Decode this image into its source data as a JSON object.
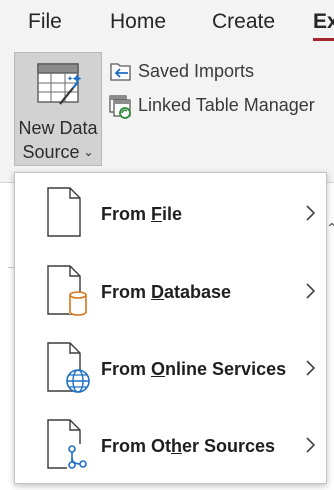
{
  "ribbon_tabs": [
    {
      "label": "File"
    },
    {
      "label": "Home"
    },
    {
      "label": "Create"
    },
    {
      "label": "Ex"
    }
  ],
  "new_data_source": {
    "line1": "New Data",
    "line2": "Source",
    "caret": "⌄"
  },
  "commands": [
    {
      "label": "Saved Imports",
      "icon": "saved-imports-icon"
    },
    {
      "label": "Linked Table Manager",
      "icon": "linked-table-manager-icon"
    }
  ],
  "menu": {
    "items": [
      {
        "prefix": "From ",
        "accel": "F",
        "suffix": "ile",
        "icon": "file-icon"
      },
      {
        "prefix": "From ",
        "accel": "D",
        "suffix": "atabase",
        "icon": "database-icon"
      },
      {
        "prefix": "From ",
        "accel": "O",
        "suffix": "nline Services",
        "icon": "online-services-icon"
      },
      {
        "prefix": "From Ot",
        "accel": "h",
        "suffix": "er Sources",
        "icon": "other-sources-icon"
      }
    ]
  },
  "colors": {
    "accent_orange": "#d4761c",
    "globe_blue": "#1f6fc4",
    "tab_underline": "#a4262c",
    "ribbon_bg": "#f3f3f3"
  }
}
